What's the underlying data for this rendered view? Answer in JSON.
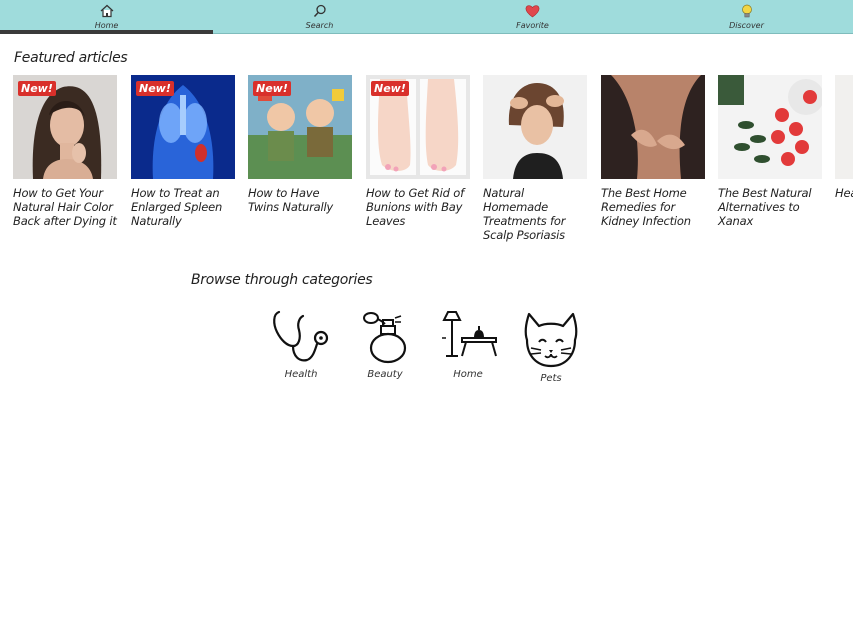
{
  "nav": {
    "items": [
      {
        "label": "Home",
        "icon": "home-icon"
      },
      {
        "label": "Search",
        "icon": "search-icon"
      },
      {
        "label": "Favorite",
        "icon": "heart-icon"
      },
      {
        "label": "Discover",
        "icon": "lightbulb-icon"
      }
    ],
    "active": "Home",
    "bar_color": "#9fdcdc"
  },
  "featured": {
    "title": "Featured articles",
    "badge_label": "New!",
    "articles": [
      {
        "title": "How to Get Your Natural Hair Color Back after Dying it",
        "is_new": true
      },
      {
        "title": "How to Treat an Enlarged Spleen Naturally",
        "is_new": true
      },
      {
        "title": "How to Have Twins Naturally",
        "is_new": true
      },
      {
        "title": "How to Get Rid of Bunions with Bay Leaves",
        "is_new": true
      },
      {
        "title": "Natural Homemade Treatments for Scalp Psoriasis",
        "is_new": false
      },
      {
        "title": "The Best Home Remedies for Kidney Infection",
        "is_new": false
      },
      {
        "title": "The Best Natural Alternatives to Xanax",
        "is_new": false
      },
      {
        "title": "Hea Um",
        "is_new": false
      }
    ]
  },
  "categories": {
    "title": "Browse through categories",
    "items": [
      {
        "label": "Health",
        "icon": "stethoscope-icon"
      },
      {
        "label": "Beauty",
        "icon": "perfume-icon"
      },
      {
        "label": "Home",
        "icon": "furniture-icon"
      },
      {
        "label": "Pets",
        "icon": "cat-icon"
      }
    ]
  },
  "colors": {
    "badge": "#d9302b",
    "nav_background": "#9fdcdc",
    "active_indicator": "#3a3a3a"
  }
}
